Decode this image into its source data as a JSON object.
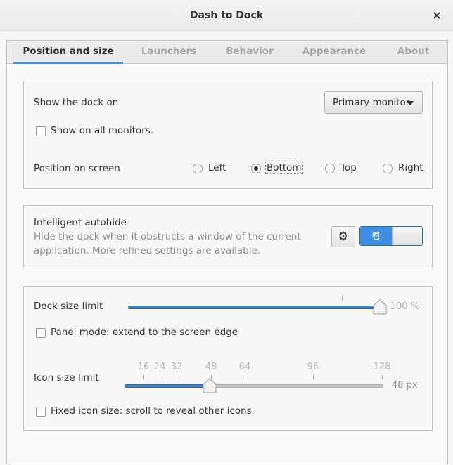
{
  "window": {
    "title": "Dash to Dock",
    "close_glyph": "×"
  },
  "tabs": [
    {
      "label": "Position and size",
      "active": true
    },
    {
      "label": "Launchers",
      "active": false
    },
    {
      "label": "Behavior",
      "active": false
    },
    {
      "label": "Appearance",
      "active": false
    },
    {
      "label": "About",
      "active": false
    }
  ],
  "position": {
    "show_dock_on_label": "Show the dock on",
    "monitor_select": {
      "value": "Primary monitor",
      "icon": "chevron-down-icon"
    },
    "all_monitors": {
      "label": "Show on all monitors.",
      "checked": false
    },
    "position_label": "Position on screen",
    "options": [
      {
        "label": "Left",
        "selected": false
      },
      {
        "label": "Bottom",
        "selected": true
      },
      {
        "label": "Top",
        "selected": false
      },
      {
        "label": "Right",
        "selected": false
      }
    ]
  },
  "autohide": {
    "title": "Intelligent autohide",
    "description_line1": "Hide the dock when it obstructs a window of the current",
    "description_line2": "application. More refined settings are available.",
    "settings_icon": "gear-icon",
    "toggle_label": "켬",
    "enabled": true
  },
  "size": {
    "dock_size_label": "Dock size limit",
    "dock_size_value": "100 %",
    "dock_size_fraction": 1.0,
    "panel_mode": {
      "label": "Panel mode: extend to the screen edge",
      "checked": false
    },
    "icon_size_label": "Icon size limit",
    "icon_size_marks": [
      "16",
      "24",
      "32",
      "48",
      "64",
      "96",
      "128"
    ],
    "icon_size_value": "48 px",
    "icon_size_fraction": 0.33,
    "fixed_icon": {
      "label": "Fixed icon size: scroll to reveal other icons",
      "checked": false
    }
  },
  "colors": {
    "accent": "#3d8ee2",
    "slider_fill": "#3d7fc9",
    "window_bg": "#f6f6f5"
  }
}
